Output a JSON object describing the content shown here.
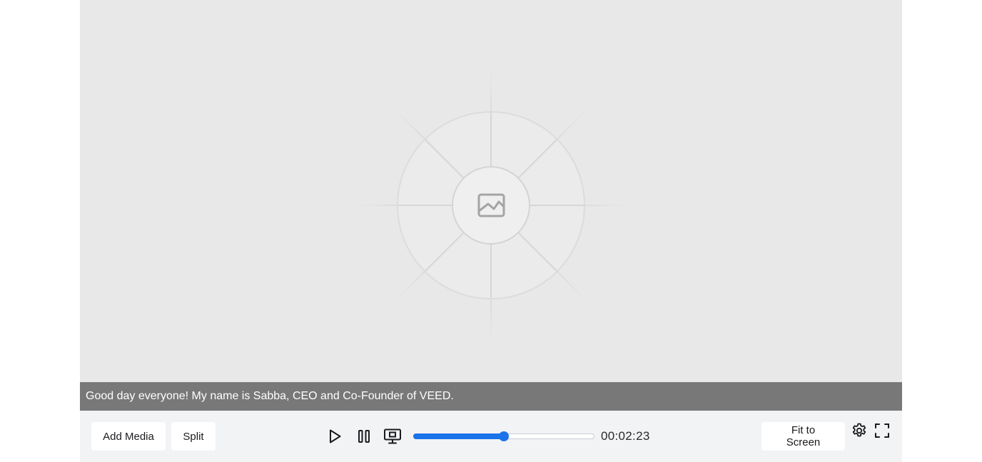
{
  "player": {
    "caption": "Good day everyone! My name is Sabba, CEO and Co-Founder of VEED.",
    "placeholder_icon": "image-icon"
  },
  "toolbar": {
    "add_media_label": "Add Media",
    "split_label": "Split",
    "fit_to_screen_label": "Fit to Screen",
    "timecode": "00:02:23",
    "progress_fraction": 0.5,
    "accent_color": "#1a73e8",
    "icons": [
      "play-icon",
      "pause-icon",
      "screen-icon",
      "gear-icon",
      "fullscreen-icon"
    ]
  }
}
